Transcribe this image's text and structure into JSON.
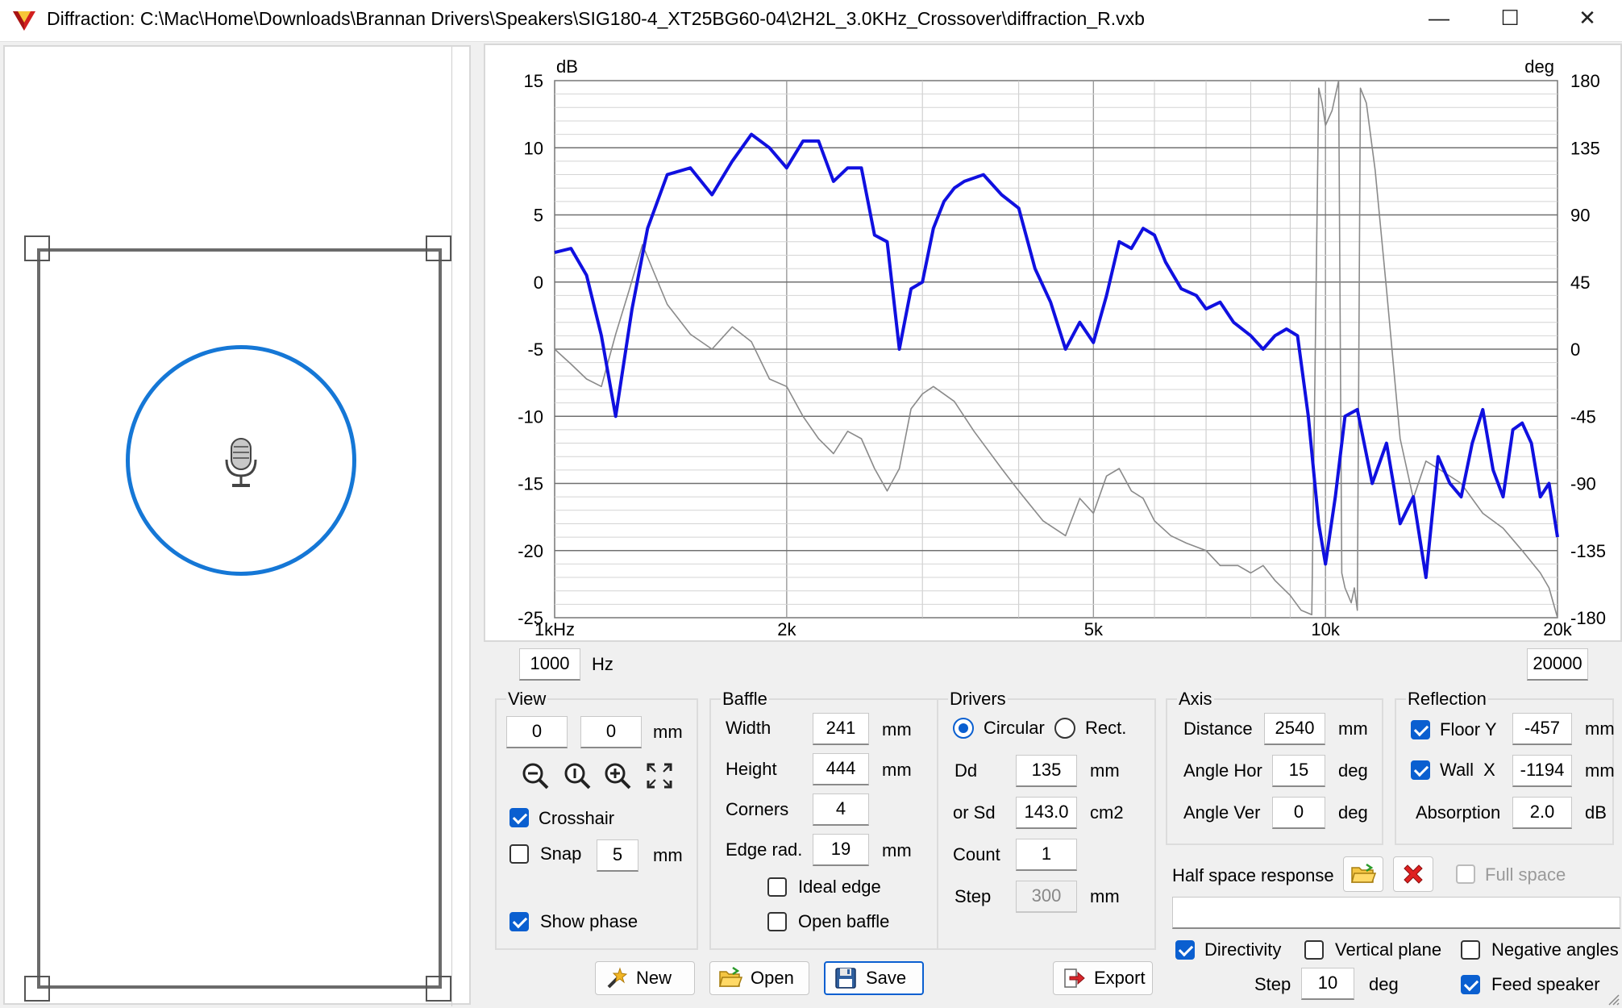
{
  "window": {
    "title": "Diffraction: C:\\Mac\\Home\\Downloads\\Brannan Drivers\\Speakers\\SIG180-4_XT25BG60-04\\2H2L_3.0KHz_Crossover\\diffraction_R.vxb",
    "minimize": "—",
    "maximize": "☐",
    "close": "✕"
  },
  "chart_data": {
    "type": "line",
    "ylabel_left": "dB",
    "ylabel_right": "deg",
    "x_scale": "log",
    "xlim": [
      1000,
      20000
    ],
    "ylim_left": [
      -25,
      15
    ],
    "ylim_right": [
      -180,
      180
    ],
    "x_tick_labels": [
      "1kHz",
      "2k",
      "5k",
      "10k",
      "20k"
    ],
    "x_ticks": [
      1000,
      2000,
      5000,
      10000,
      20000
    ],
    "y_left_tick_labels": [
      "15",
      "10",
      "5",
      "0",
      "-5",
      "-10",
      "-15",
      "-20",
      "-25"
    ],
    "y_right_tick_labels": [
      "180",
      "135",
      "90",
      "45",
      "0",
      "-45",
      "-90",
      "-135",
      "-180"
    ],
    "grid": true,
    "series": [
      {
        "role": "magnitude",
        "axis": "left",
        "color": "#1010e0",
        "x": [
          1000,
          1050,
          1100,
          1150,
          1200,
          1260,
          1320,
          1400,
          1500,
          1600,
          1700,
          1800,
          1900,
          2000,
          2100,
          2200,
          2300,
          2400,
          2500,
          2600,
          2700,
          2800,
          2900,
          3000,
          3100,
          3200,
          3300,
          3400,
          3600,
          3800,
          4000,
          4200,
          4400,
          4600,
          4800,
          5000,
          5200,
          5400,
          5600,
          5800,
          6000,
          6200,
          6500,
          6800,
          7000,
          7300,
          7600,
          8000,
          8300,
          8600,
          8900,
          9200,
          9500,
          9800,
          10000,
          10300,
          10600,
          11000,
          11500,
          12000,
          12500,
          13000,
          13500,
          14000,
          14500,
          15000,
          15500,
          16000,
          16500,
          17000,
          17500,
          18000,
          18500,
          19000,
          19500,
          20000
        ],
        "values": [
          2.2,
          2.5,
          0.5,
          -4,
          -10,
          -2,
          4,
          8,
          8.5,
          6.5,
          9,
          11,
          10,
          8.5,
          10.5,
          10.5,
          7.5,
          8.5,
          8.5,
          3.5,
          3,
          -5,
          -0.5,
          0,
          4,
          6,
          7,
          7.5,
          8,
          6.5,
          5.5,
          1,
          -1.5,
          -5,
          -3,
          -4.5,
          -1,
          3,
          2.5,
          4,
          3.5,
          1.5,
          -0.5,
          -1,
          -2,
          -1.5,
          -3,
          -4,
          -5,
          -4,
          -3.5,
          -4,
          -10,
          -18,
          -21,
          -16,
          -10,
          -9.5,
          -15,
          -12,
          -18,
          -16,
          -22,
          -13,
          -15,
          -16,
          -12,
          -9.5,
          -14,
          -16,
          -11,
          -10.5,
          -12,
          -16,
          -15,
          -19
        ]
      },
      {
        "role": "phase",
        "axis": "right",
        "color": "#8a8a8a",
        "x": [
          1000,
          1050,
          1100,
          1150,
          1200,
          1250,
          1300,
          1400,
          1500,
          1600,
          1700,
          1800,
          1900,
          2000,
          2100,
          2200,
          2300,
          2400,
          2500,
          2600,
          2700,
          2800,
          2900,
          3000,
          3100,
          3300,
          3500,
          3800,
          4000,
          4300,
          4600,
          4800,
          5000,
          5200,
          5400,
          5600,
          5800,
          6000,
          6300,
          6600,
          7000,
          7300,
          7700,
          8000,
          8300,
          8600,
          9000,
          9300,
          9600,
          9800,
          9850,
          9900,
          10000,
          10200,
          10400,
          10500,
          10600,
          10700,
          10800,
          10900,
          11000,
          11100,
          11300,
          11600,
          12000,
          12500,
          13000,
          13500,
          14000,
          15000,
          16000,
          17000,
          18000,
          19000,
          19500,
          20000
        ],
        "values": [
          0,
          -10,
          -20,
          -25,
          10,
          40,
          70,
          30,
          10,
          0,
          15,
          5,
          -20,
          -25,
          -45,
          -60,
          -70,
          -55,
          -60,
          -80,
          -95,
          -80,
          -40,
          -30,
          -25,
          -35,
          -55,
          -80,
          -95,
          -115,
          -125,
          -100,
          -110,
          -85,
          -80,
          -95,
          -100,
          -115,
          -125,
          -130,
          -135,
          -145,
          -145,
          -150,
          -145,
          -155,
          -165,
          -175,
          -178,
          175,
          170,
          165,
          150,
          160,
          180,
          -150,
          -160,
          -165,
          -170,
          -160,
          -175,
          175,
          165,
          120,
          40,
          -60,
          -100,
          -75,
          -80,
          -90,
          -110,
          -120,
          -135,
          -150,
          -160,
          -180
        ]
      }
    ]
  },
  "freq": {
    "min": "1000",
    "unit": "Hz",
    "max": "20000"
  },
  "view": {
    "title": "View",
    "x": "0",
    "y": "0",
    "unit": "mm",
    "crosshair_label": "Crosshair",
    "crosshair": true,
    "snap_label": "Snap",
    "snap": false,
    "snap_value": "5",
    "snap_unit": "mm",
    "show_phase_label": "Show phase",
    "show_phase": true
  },
  "baffle": {
    "title": "Baffle",
    "width_label": "Width",
    "width": "241",
    "height_label": "Height",
    "height": "444",
    "corners_label": "Corners",
    "corners": "4",
    "edge_label": "Edge rad.",
    "edge": "19",
    "unit": "mm",
    "ideal_edge_label": "Ideal edge",
    "open_baffle_label": "Open baffle"
  },
  "drivers": {
    "title": "Drivers",
    "circular_label": "Circular",
    "rect_label": "Rect.",
    "dd_label": "Dd",
    "dd": "135",
    "dd_unit": "mm",
    "sd_label": "or Sd",
    "sd": "143.0",
    "sd_unit": "cm2",
    "count_label": "Count",
    "count": "1",
    "step_label": "Step",
    "step": "300",
    "step_unit": "mm"
  },
  "axis": {
    "title": "Axis",
    "distance_label": "Distance",
    "distance": "2540",
    "distance_unit": "mm",
    "angle_hor_label": "Angle Hor",
    "angle_hor": "15",
    "angle_ver_label": "Angle Ver",
    "angle_ver": "0",
    "deg": "deg"
  },
  "reflection": {
    "title": "Reflection",
    "floor_label": "Floor Y",
    "floor": "-457",
    "wall_label": "Wall  X",
    "wall": "-1194",
    "absorption_label": "Absorption",
    "absorption": "2.0",
    "unit": "mm",
    "db": "dB"
  },
  "half_space": {
    "label": "Half space response",
    "full_space_label": "Full space",
    "directivity_label": "Directivity",
    "vertical_plane_label": "Vertical plane",
    "negative_angles_label": "Negative angles",
    "step_label": "Step",
    "step": "10",
    "step_unit": "deg",
    "feed_speaker_label": "Feed speaker"
  },
  "buttons": {
    "new": "New",
    "open": "Open",
    "save": "Save",
    "export": "Export"
  }
}
